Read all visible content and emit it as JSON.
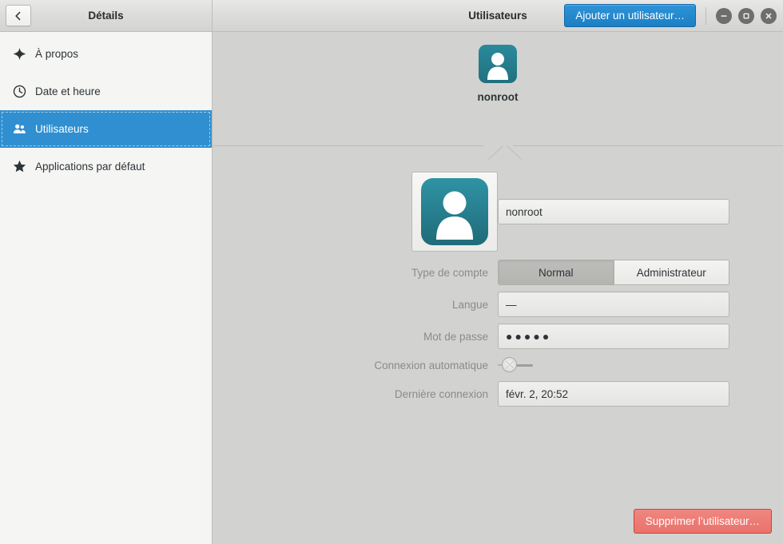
{
  "window": {
    "left_title": "Détails",
    "right_title": "Utilisateurs"
  },
  "header": {
    "back_icon": "chevron-left-icon",
    "add_user_label": "Ajouter un utilisateur…",
    "minimize_label": "−",
    "maximize_label": "□",
    "close_label": "×",
    "accent_color": "#1b7fc4"
  },
  "sidebar": {
    "items": [
      {
        "label": "À propos",
        "icon": "sparkle-icon",
        "selected": false
      },
      {
        "label": "Date et heure",
        "icon": "clock-icon",
        "selected": false
      },
      {
        "label": "Utilisateurs",
        "icon": "people-icon",
        "selected": true
      },
      {
        "label": "Applications par défaut",
        "icon": "star-icon",
        "selected": false
      }
    ],
    "selected_color": "#2f8fd0"
  },
  "user_strip": {
    "users": [
      {
        "name": "nonroot",
        "avatar_icon": "user-avatar-icon",
        "selected": true
      }
    ]
  },
  "details": {
    "avatar_icon": "user-avatar-icon",
    "name_value": "nonroot",
    "rows": {
      "account_type": {
        "label": "Type de compte",
        "options": [
          "Normal",
          "Administrateur"
        ],
        "selected": "Normal"
      },
      "language": {
        "label": "Langue",
        "value": "—"
      },
      "password": {
        "label": "Mot de passe",
        "value": "●●●●●"
      },
      "auto_login": {
        "label": "Connexion automatique",
        "state": "off"
      },
      "last_login": {
        "label": "Dernière connexion",
        "value": "févr.  2, 20:52"
      }
    },
    "delete_label": "Supprimer l’utilisateur…",
    "delete_color": "#ea726b"
  }
}
